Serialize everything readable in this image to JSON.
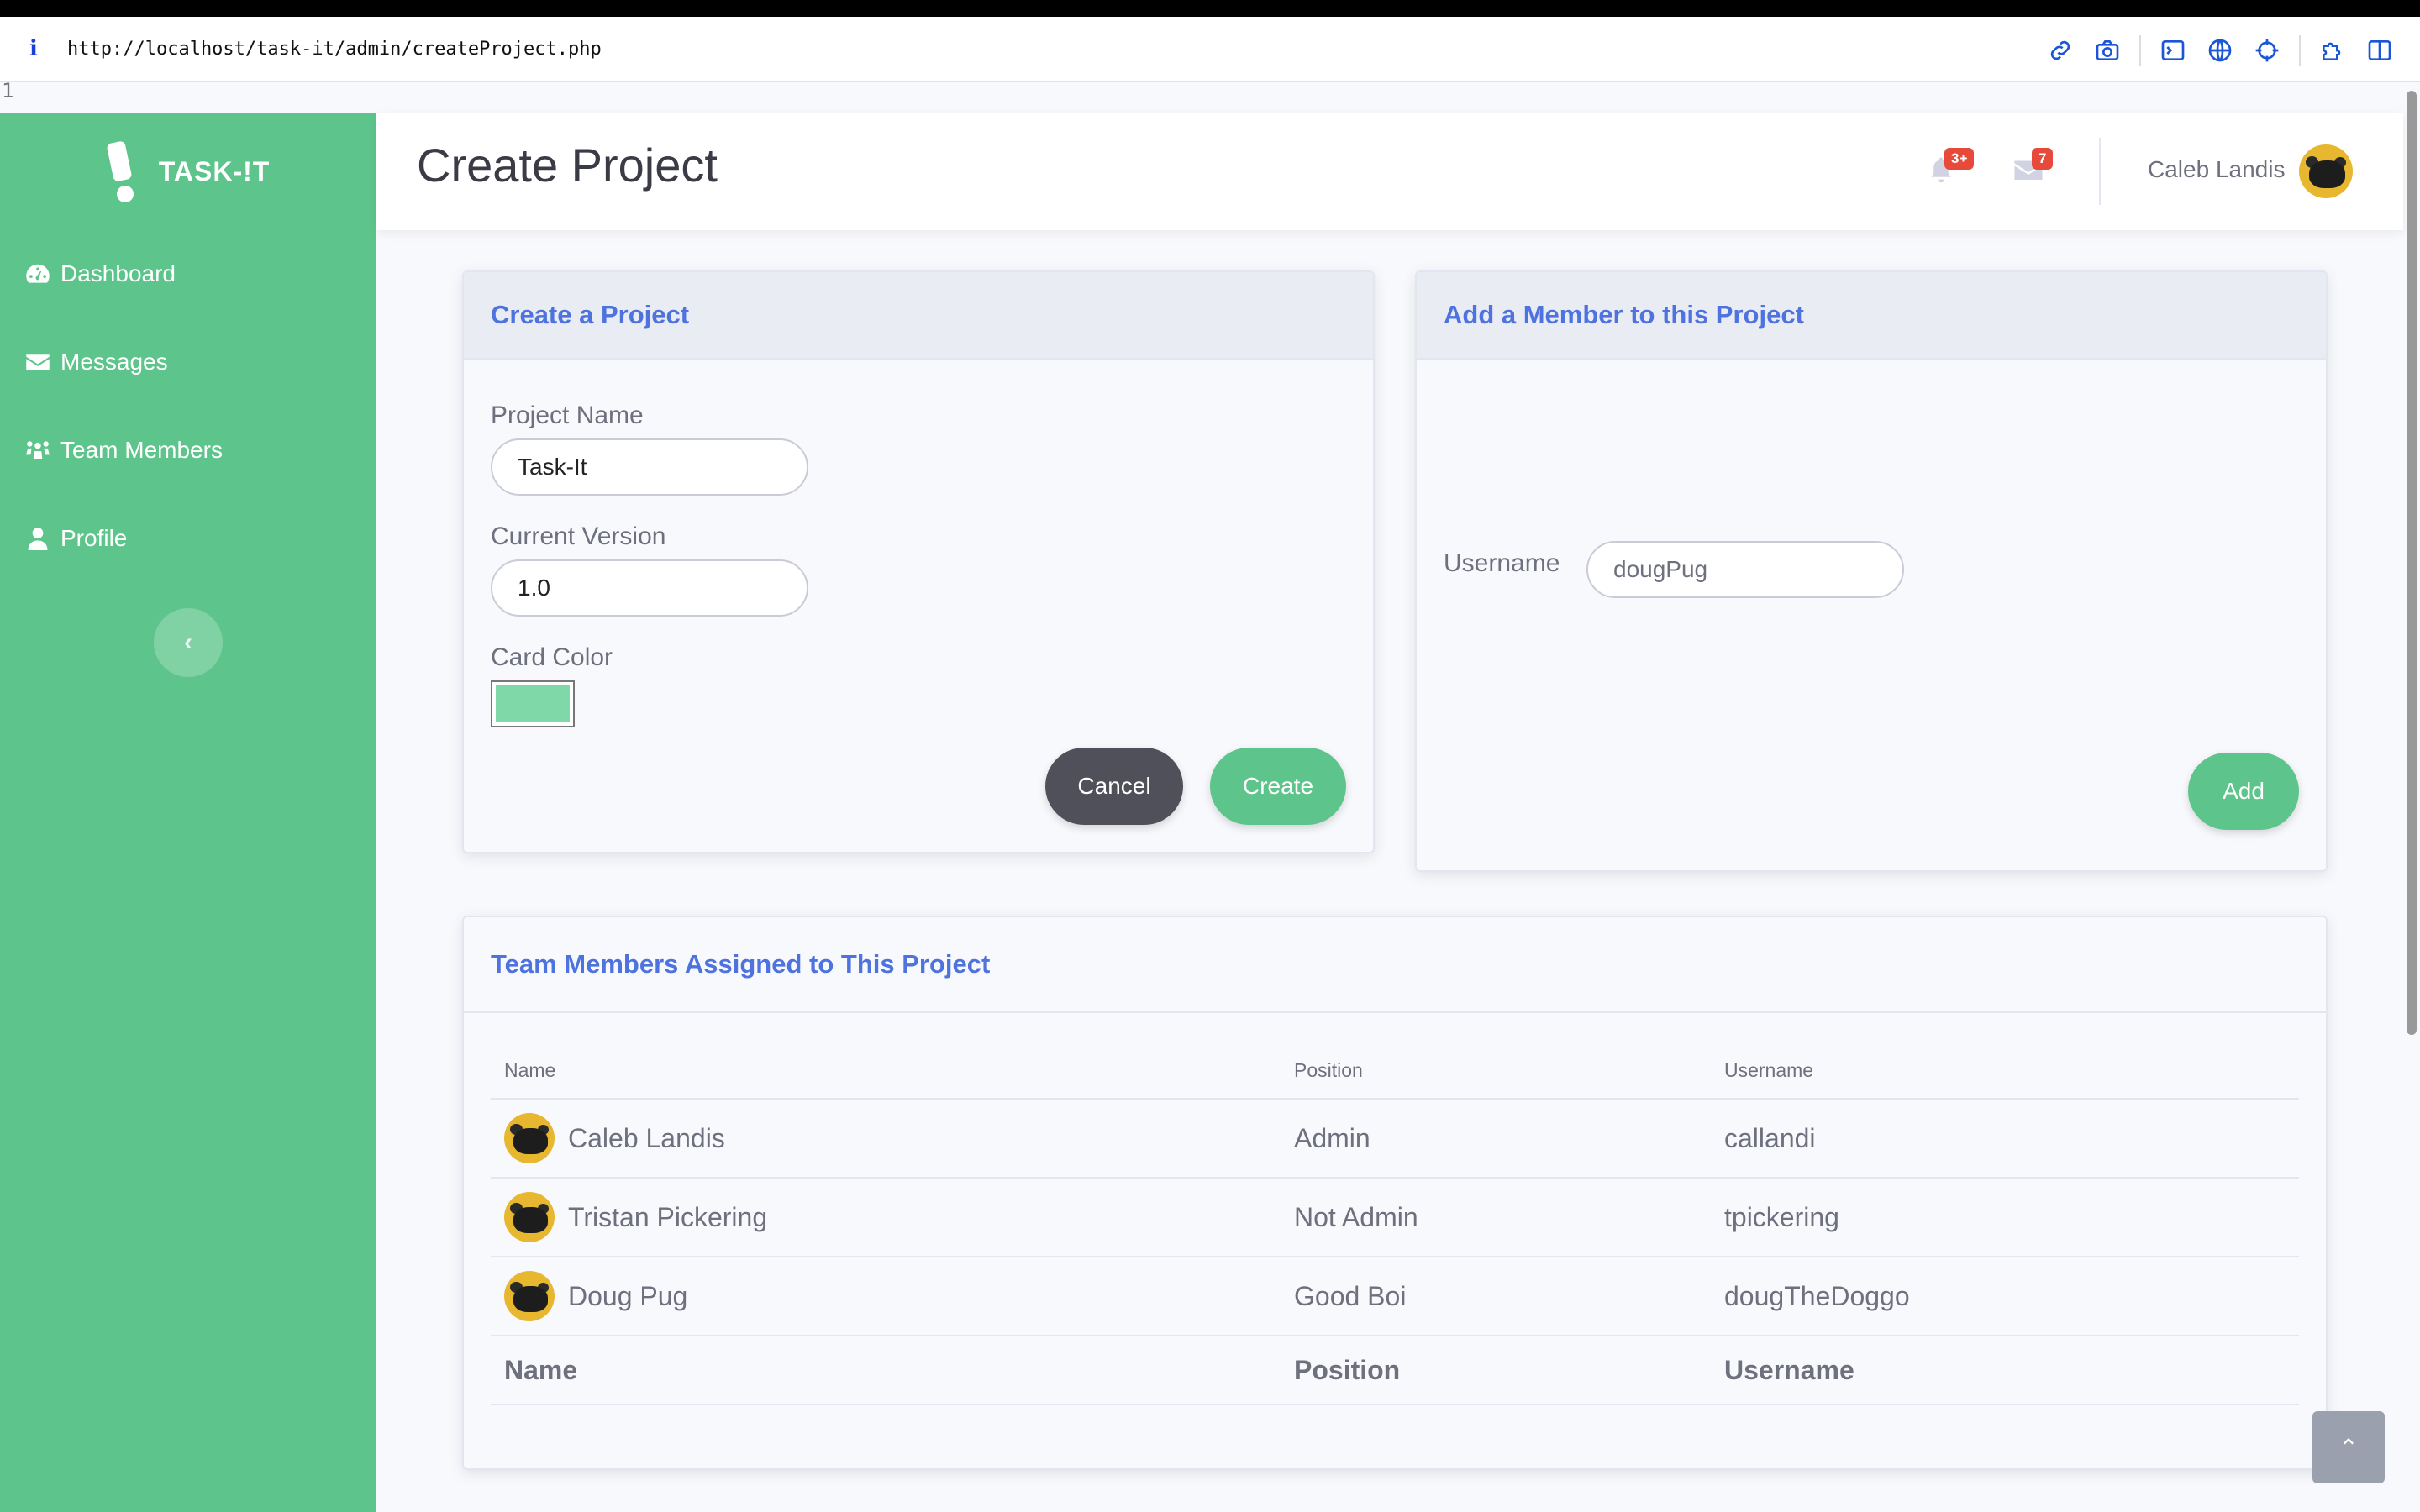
{
  "browser": {
    "url": "http://localhost/task-it/admin/createProject.php",
    "line_number": "1"
  },
  "sidebar": {
    "brand": "TASK-!T",
    "items": [
      {
        "label": "Dashboard",
        "icon": "dashboard-gauge-icon"
      },
      {
        "label": "Messages",
        "icon": "envelope-icon"
      },
      {
        "label": "Team Members",
        "icon": "users-icon"
      },
      {
        "label": "Profile",
        "icon": "user-icon"
      }
    ],
    "toggle_glyph": "‹"
  },
  "header": {
    "title": "Create Project",
    "alerts_badge": "3+",
    "messages_badge": "7",
    "user_name": "Caleb Landis"
  },
  "create_card": {
    "title": "Create a Project",
    "project_name_label": "Project Name",
    "project_name_value": "Task-It",
    "version_label": "Current Version",
    "version_value": "1.0",
    "card_color_label": "Card Color",
    "card_color": "#7ed8a8",
    "cancel_label": "Cancel",
    "create_label": "Create"
  },
  "member_card": {
    "title": "Add a Member to this Project",
    "username_label": "Username",
    "username_value": "dougPug",
    "add_label": "Add"
  },
  "team_card": {
    "title": "Team Members Assigned to This Project",
    "columns": [
      "Name",
      "Position",
      "Username"
    ],
    "rows": [
      {
        "name": "Caleb Landis",
        "position": "Admin",
        "username": "callandi"
      },
      {
        "name": "Tristan Pickering",
        "position": "Not Admin",
        "username": "tpickering"
      },
      {
        "name": "Doug Pug",
        "position": "Good Boi",
        "username": "dougTheDoggo"
      }
    ]
  },
  "colors": {
    "sidebar": "#5dc58b",
    "accent": "#4e73df",
    "badge": "#e74a3b"
  }
}
